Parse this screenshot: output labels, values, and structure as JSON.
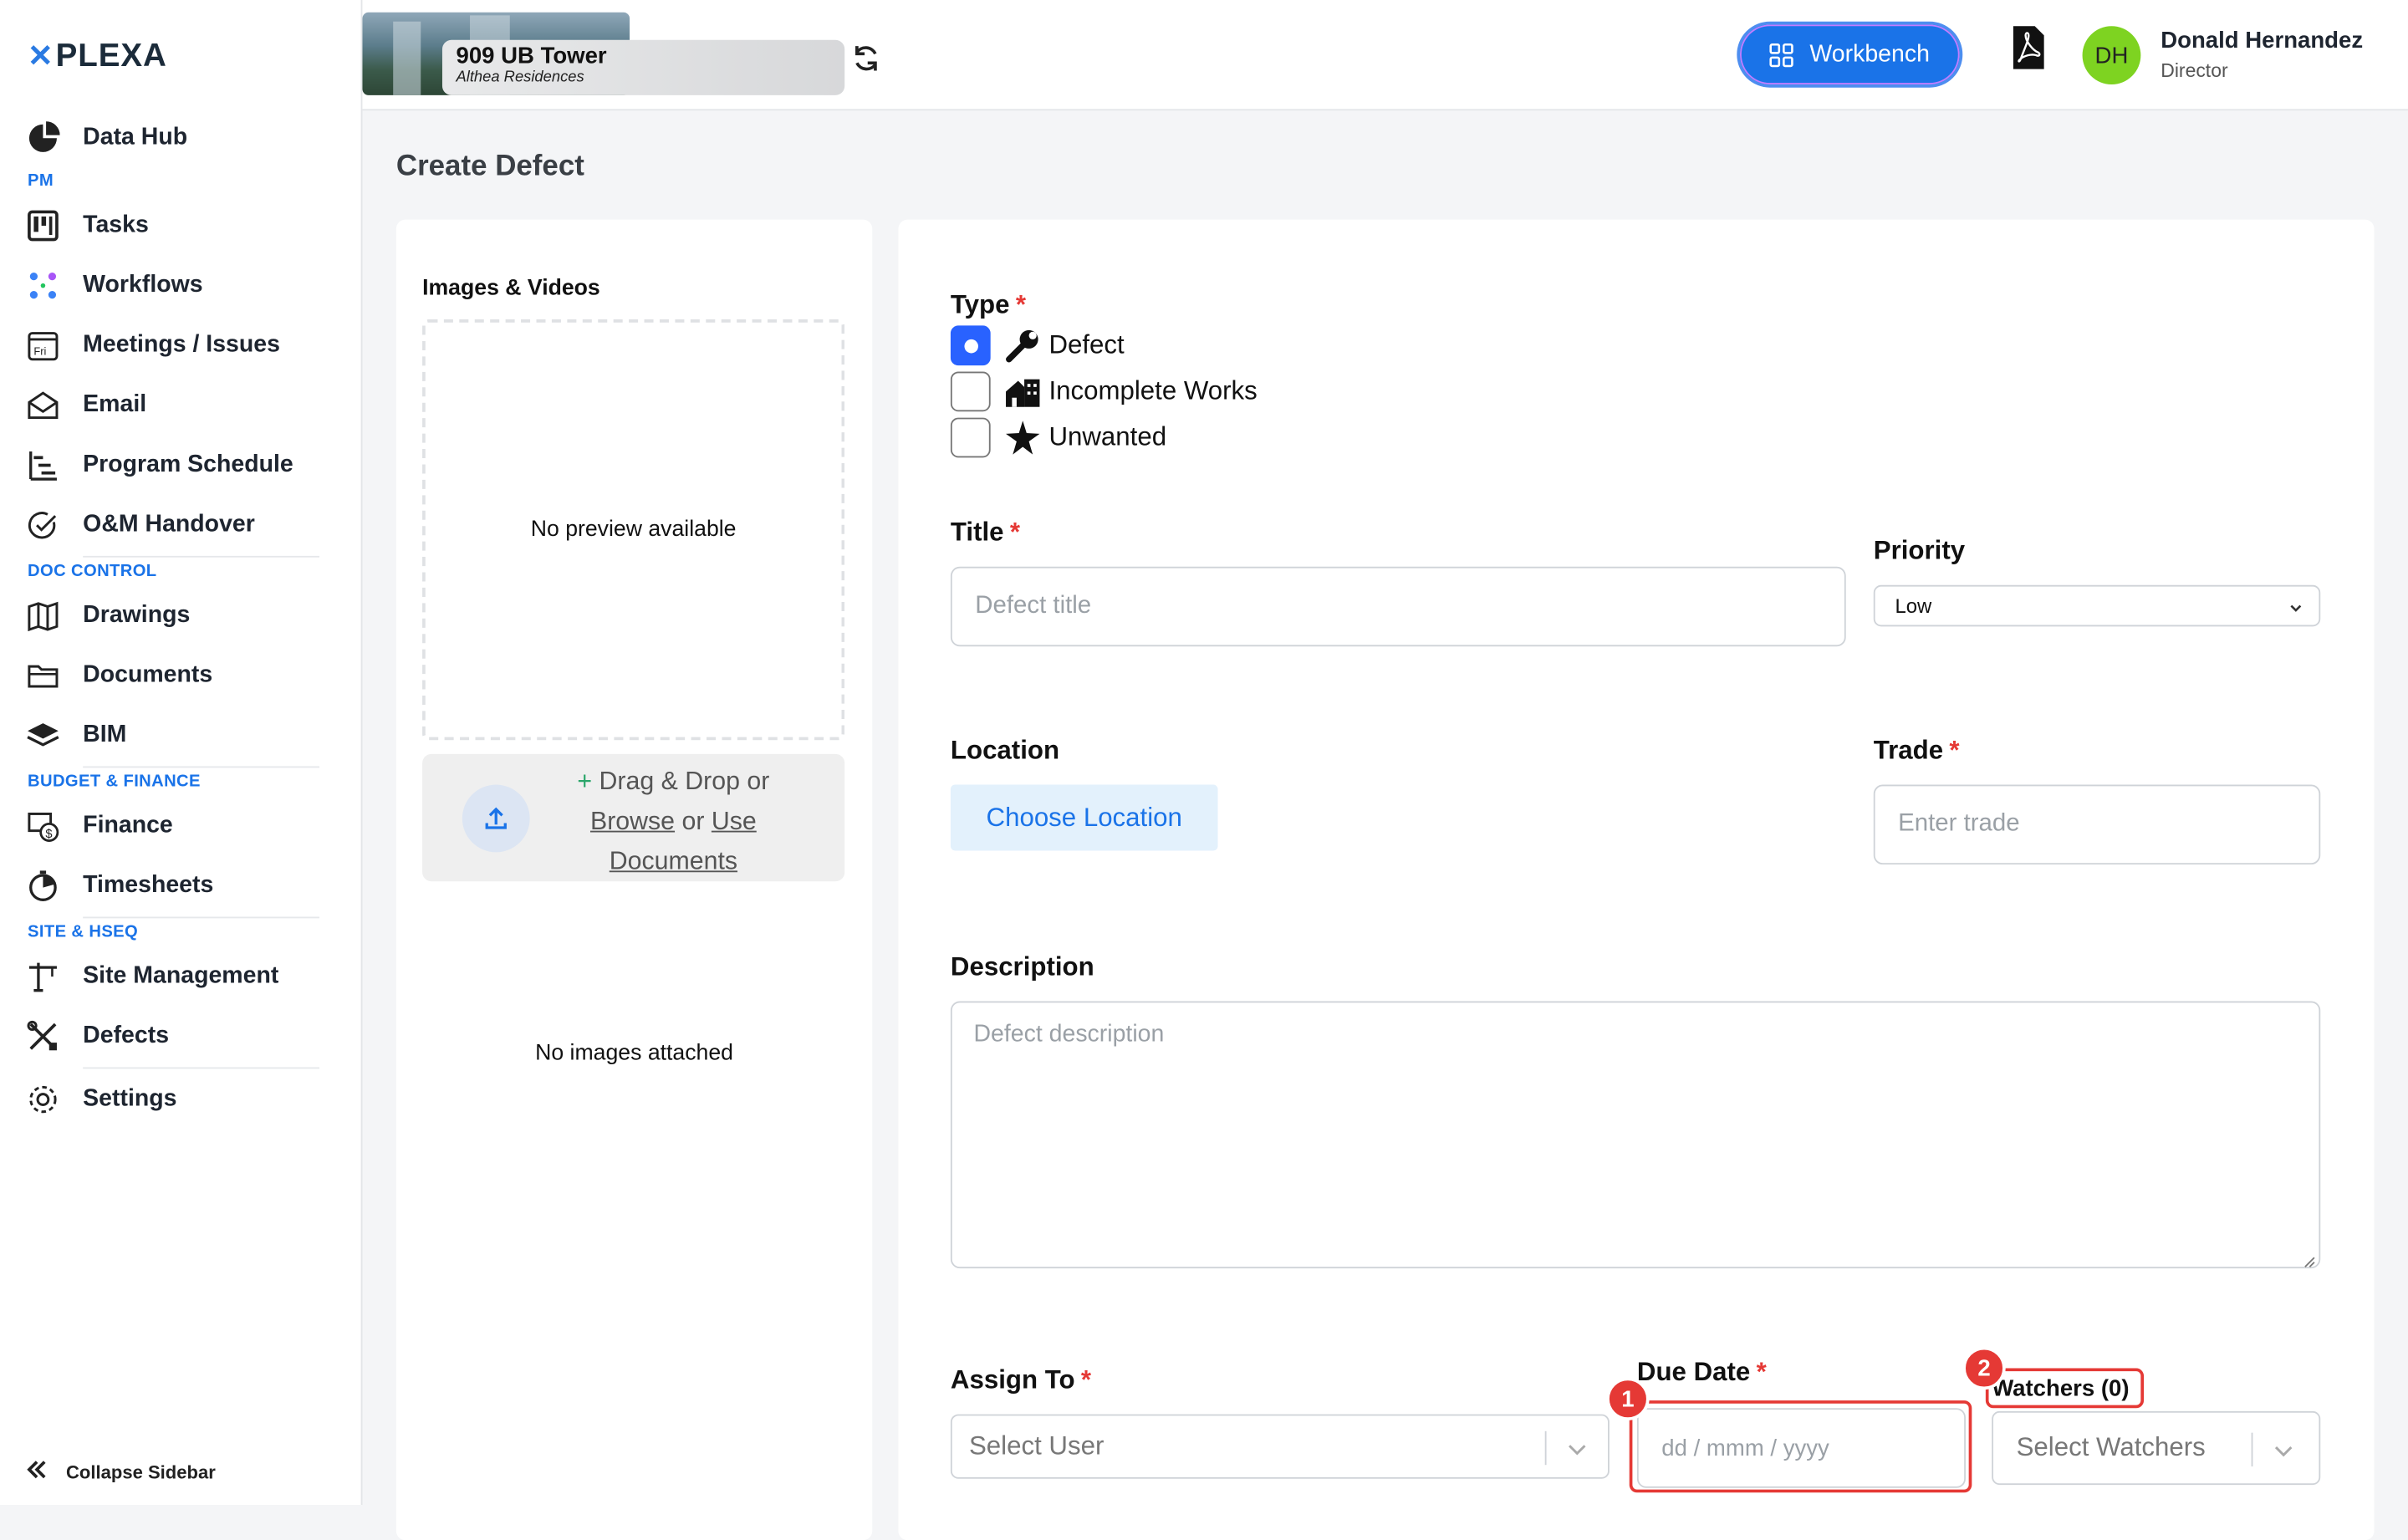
{
  "brand": {
    "logo": "PLEXA",
    "logo_mark": "✕",
    "accent": "#1a73e8"
  },
  "sidebar": {
    "items": [
      {
        "label": "Data Hub",
        "icon": "pie-chart-icon"
      },
      {
        "label": "Tasks",
        "icon": "kanban-icon"
      },
      {
        "label": "Workflows",
        "icon": "workflow-icon"
      },
      {
        "label": "Meetings / Issues",
        "icon": "calendar-icon"
      },
      {
        "label": "Email",
        "icon": "envelope-icon"
      },
      {
        "label": "Program Schedule",
        "icon": "gantt-icon"
      },
      {
        "label": "O&M Handover",
        "icon": "check-circle-icon"
      },
      {
        "label": "Drawings",
        "icon": "map-icon"
      },
      {
        "label": "Documents",
        "icon": "folder-icon"
      },
      {
        "label": "BIM",
        "icon": "layers-icon"
      },
      {
        "label": "Finance",
        "icon": "finance-icon"
      },
      {
        "label": "Timesheets",
        "icon": "stopwatch-icon"
      },
      {
        "label": "Site Management",
        "icon": "crane-icon"
      },
      {
        "label": "Defects",
        "icon": "tools-icon"
      },
      {
        "label": "Settings",
        "icon": "gear-icon"
      }
    ],
    "sections": {
      "pm": "PM",
      "doc": "DOC CONTROL",
      "budget": "BUDGET & FINANCE",
      "site": "SITE & HSEQ"
    },
    "calendar_icon_text": "Fri",
    "collapse_label": "Collapse Sidebar"
  },
  "header": {
    "project_name": "909 UB Tower",
    "project_sub": "Althea Residences",
    "workbench_label": "Workbench",
    "user_initials": "DH",
    "user_name": "Donald Hernandez",
    "user_role": "Director"
  },
  "page": {
    "title": "Create Defect"
  },
  "media": {
    "title": "Images & Videos",
    "no_preview": "No preview available",
    "upload_plus": "+",
    "upload_drag": "Drag & Drop or",
    "upload_browse": "Browse",
    "upload_or": "or",
    "upload_use_docs": "Use Documents",
    "no_images": "No images attached"
  },
  "form": {
    "type_label": "Type",
    "types": [
      {
        "label": "Defect",
        "checked": true,
        "icon": "wrench-icon"
      },
      {
        "label": "Incomplete Works",
        "checked": false,
        "icon": "building-icon"
      },
      {
        "label": "Unwanted",
        "checked": false,
        "icon": "star-burst-icon"
      }
    ],
    "title_label": "Title",
    "title_placeholder": "Defect title",
    "priority_label": "Priority",
    "priority_value": "Low",
    "location_label": "Location",
    "choose_location": "Choose Location",
    "trade_label": "Trade",
    "trade_placeholder": "Enter trade",
    "description_label": "Description",
    "description_placeholder": "Defect description",
    "assign_label": "Assign To",
    "assign_placeholder": "Select User",
    "due_label": "Due Date",
    "due_placeholder": "dd / mmm / yyyy",
    "watchers_label": "Watchers (0)",
    "watchers_placeholder": "Select Watchers",
    "required_mark": "*"
  },
  "annotations": {
    "badge1": "1",
    "badge2": "2",
    "color": "#e53935"
  }
}
